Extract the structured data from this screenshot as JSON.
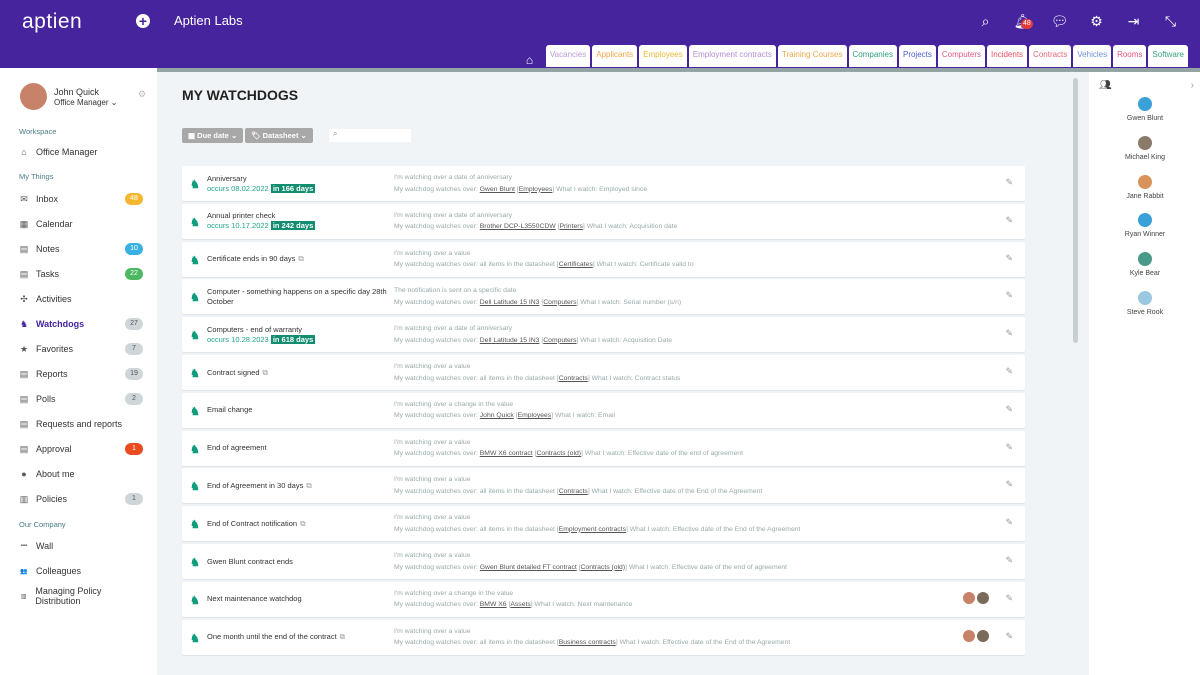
{
  "header": {
    "logo": "aptien",
    "org": "Aptien Labs",
    "notif_count": "48",
    "icons": [
      "search-icon",
      "bell-icon",
      "chat-icon",
      "gear-icon",
      "logout-icon",
      "collapse-icon"
    ]
  },
  "tabs": [
    {
      "label": "Vacancies",
      "color": "#b89ad6"
    },
    {
      "label": "Applicants",
      "color": "#f0a64a"
    },
    {
      "label": "Employees",
      "color": "#e9b830"
    },
    {
      "label": "Employment contracts",
      "color": "#b38ed4"
    },
    {
      "label": "Training Courses",
      "color": "#f0a64a"
    },
    {
      "label": "Companies",
      "color": "#2f9e83"
    },
    {
      "label": "Projects",
      "color": "#4a5ed0"
    },
    {
      "label": "Computers",
      "color": "#e6558a"
    },
    {
      "label": "Incidents",
      "color": "#e94e5d"
    },
    {
      "label": "Contracts",
      "color": "#e9667a"
    },
    {
      "label": "Vehicles",
      "color": "#6a8fe0"
    },
    {
      "label": "Rooms",
      "color": "#e94e78"
    },
    {
      "label": "Software",
      "color": "#36a07d"
    }
  ],
  "user": {
    "name": "John Quick",
    "role": "Office Manager"
  },
  "sidebar": {
    "workspace": "Workspace",
    "office": "Office Manager",
    "my_things": "My Things",
    "our_company": "Our Company",
    "items": [
      {
        "label": "Inbox",
        "icon": "✉",
        "count": "48",
        "color": "#f5b731"
      },
      {
        "label": "Calendar",
        "icon": "▦"
      },
      {
        "label": "Notes",
        "icon": "▤",
        "count": "10",
        "color": "#3bb0e3"
      },
      {
        "label": "Tasks",
        "icon": "▤",
        "count": "22",
        "color": "#4cb861"
      },
      {
        "label": "Activities",
        "icon": "✣"
      },
      {
        "label": "Watchdogs",
        "icon": "♞",
        "count": "27",
        "color": "#cfd6da",
        "active": true
      },
      {
        "label": "Favorites",
        "icon": "★",
        "count": "7",
        "color": "#cfd6da"
      },
      {
        "label": "Reports",
        "icon": "▤",
        "count": "19",
        "color": "#cfd6da"
      },
      {
        "label": "Polls",
        "icon": "▤",
        "count": "2",
        "color": "#cfd6da"
      },
      {
        "label": "Requests and reports",
        "icon": "▤"
      },
      {
        "label": "Approval",
        "icon": "▤",
        "count": "1",
        "color": "#ea4a1f"
      },
      {
        "label": "About me",
        "icon": "●"
      },
      {
        "label": "Policies",
        "icon": "▥",
        "count": "1",
        "color": "#cfd6da"
      }
    ],
    "company": [
      {
        "label": "Wall",
        "icon": "▪▪▪"
      },
      {
        "label": "Colleagues",
        "icon": "👥"
      },
      {
        "label": "Managing Policy Distribution",
        "icon": "▥"
      }
    ]
  },
  "main": {
    "title": "MY WATCHDOGS",
    "filter_due": "Due date",
    "filter_ds": "Datasheet",
    "search_placeholder": "",
    "rows": [
      {
        "title": "Anniversary",
        "occurs": "occurs 08.02.2022",
        "badge": "in 166 days",
        "desc": "I'm watching over a date of anniversary",
        "prefix": "My watchdog watches over: ",
        "item": "Gwen Blunt",
        "ds": "Employees",
        "what": "What I watch: Employed since"
      },
      {
        "title": "Annual printer check",
        "occurs": "occurs 10.17.2022",
        "badge": "in 242 days",
        "desc": "I'm watching over a date of anniversary",
        "prefix": "My watchdog watches over: ",
        "item": "Brother DCP-L3550CDW",
        "ds": "Printers",
        "what": "What I watch: Acquisition date"
      },
      {
        "title": "Certificate ends in 90 days",
        "copy": true,
        "desc": "I'm watching over a value",
        "prefix": "My watchdog watches over: all items in the datasheet ",
        "ds": "Certificates",
        "what": "What I watch: Certificate valid to"
      },
      {
        "title": "Computer - something happens on a specific day 28th October",
        "desc": "The notification is sent on a specific date",
        "prefix": "My watchdog watches over: ",
        "item": "Dell Latitude 15 IN3",
        "ds": "Computers",
        "what": "What I watch: Serial number (s/n)"
      },
      {
        "title": "Computers - end of warranty",
        "occurs": "occurs 10.28.2023",
        "badge": "in 618 days",
        "desc": "I'm watching over a date of anniversary",
        "prefix": "My watchdog watches over: ",
        "item": "Dell Latitude 15 IN3",
        "ds": "Computers",
        "what": "What I watch: Acquisition Date"
      },
      {
        "title": "Contract signed",
        "copy": true,
        "desc": "I'm watching over a value",
        "prefix": "My watchdog watches over: all items in the datasheet ",
        "ds": "Contracts",
        "what": "What I watch: Contract status"
      },
      {
        "title": "Email change",
        "desc": "I'm watching over a change in the value",
        "prefix": "My watchdog watches over: ",
        "item": "John Quick",
        "ds": "Employees",
        "what": "What I watch: Email"
      },
      {
        "title": "End of agreement",
        "desc": "I'm watching over a value",
        "prefix": "My watchdog watches over: ",
        "item": "BMW X6 contract",
        "ds": "Contracts (old)",
        "what": "What I watch: Effective date of the end of agreement"
      },
      {
        "title": "End of Agreement in 30 days",
        "copy": true,
        "desc": "I'm watching over a value",
        "prefix": "My watchdog watches over: all items in the datasheet ",
        "ds": "Contracts",
        "what": "What I watch: Effective date of the End of the Agreement"
      },
      {
        "title": "End of Contract notification",
        "copy": true,
        "desc": "I'm watching over a value",
        "prefix": "My watchdog watches over: all items in the datasheet ",
        "ds": "Employment contracts",
        "what": "What I watch: Effective date of the End of the Agreement"
      },
      {
        "title": "Gwen Blunt contract ends",
        "desc": "I'm watching over a value",
        "prefix": "My watchdog watches over: ",
        "item": "Gwen Blunt detailed FT contract",
        "ds": "Contracts (old)",
        "what": "What I watch: Effective date of the end of agreement"
      },
      {
        "title": "Next maintenance watchdog",
        "avatars": true,
        "desc": "I'm watching over a change in the value",
        "prefix": "My watchdog watches over: ",
        "item": "BMW X6",
        "ds": "Assets",
        "what": "What I watch: Next maintenance"
      },
      {
        "title": "One month until the end of the contract",
        "copy": true,
        "avatars": true,
        "desc": "I'm watching over a value",
        "prefix": "My watchdog watches over: all items in the datasheet ",
        "ds": "Business contracts",
        "what": "What I watch: Effective date of the End of the Agreement"
      }
    ]
  },
  "colleagues": [
    "Gwen Blunt",
    "Michael King",
    "Jane Rabbit",
    "Ryan Winner",
    "Kyle Bear",
    "Steve Rook"
  ]
}
